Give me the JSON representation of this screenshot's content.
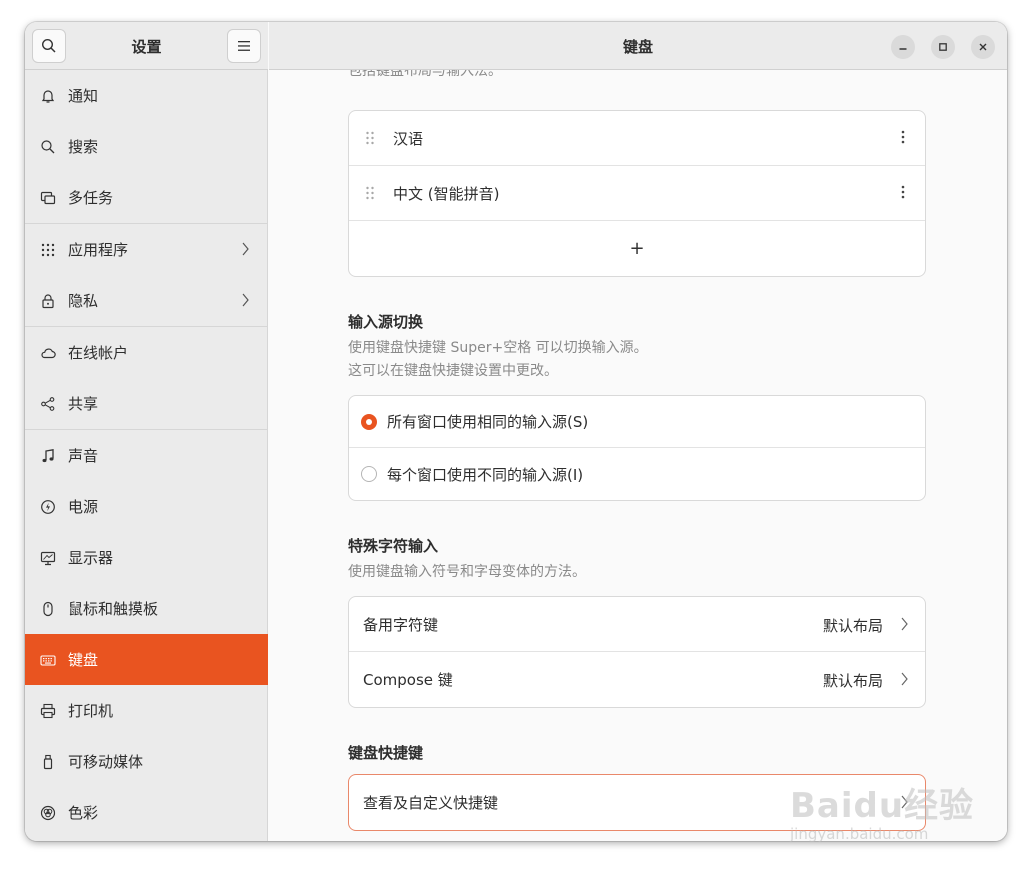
{
  "sidebar": {
    "title": "设置",
    "items": [
      {
        "label": "通知"
      },
      {
        "label": "搜索"
      },
      {
        "label": "多任务"
      },
      {
        "label": "应用程序"
      },
      {
        "label": "隐私"
      },
      {
        "label": "在线帐户"
      },
      {
        "label": "共享"
      },
      {
        "label": "声音"
      },
      {
        "label": "电源"
      },
      {
        "label": "显示器"
      },
      {
        "label": "鼠标和触摸板"
      },
      {
        "label": "键盘"
      },
      {
        "label": "打印机"
      },
      {
        "label": "可移动媒体"
      },
      {
        "label": "色彩"
      }
    ],
    "active_item": "键盘"
  },
  "header": {
    "title": "键盘"
  },
  "input_sources": {
    "cut_text": "包括键盘布局与输入法。",
    "items": [
      {
        "label": "汉语"
      },
      {
        "label": "中文 (智能拼音)"
      }
    ],
    "add_label": "+"
  },
  "switching": {
    "title": "输入源切换",
    "desc_line1": "使用键盘快捷键 Super+空格 可以切换输入源。",
    "desc_line2": "这可以在键盘快捷键设置中更改。",
    "option1": "所有窗口使用相同的输入源(S)",
    "option2": "每个窗口使用不同的输入源(I)",
    "selected": 1
  },
  "special_chars": {
    "title": "特殊字符输入",
    "desc": "使用键盘输入符号和字母变体的方法。",
    "rows": [
      {
        "label": "备用字符键",
        "value": "默认布局"
      },
      {
        "label": "Compose 键",
        "value": "默认布局"
      }
    ]
  },
  "shortcuts": {
    "title": "键盘快捷键",
    "row_label": "查看及自定义快捷键"
  },
  "watermark": {
    "brand": "Baidu经验",
    "url": "jingyan.baidu.com"
  },
  "colors": {
    "accent": "#e95420"
  }
}
